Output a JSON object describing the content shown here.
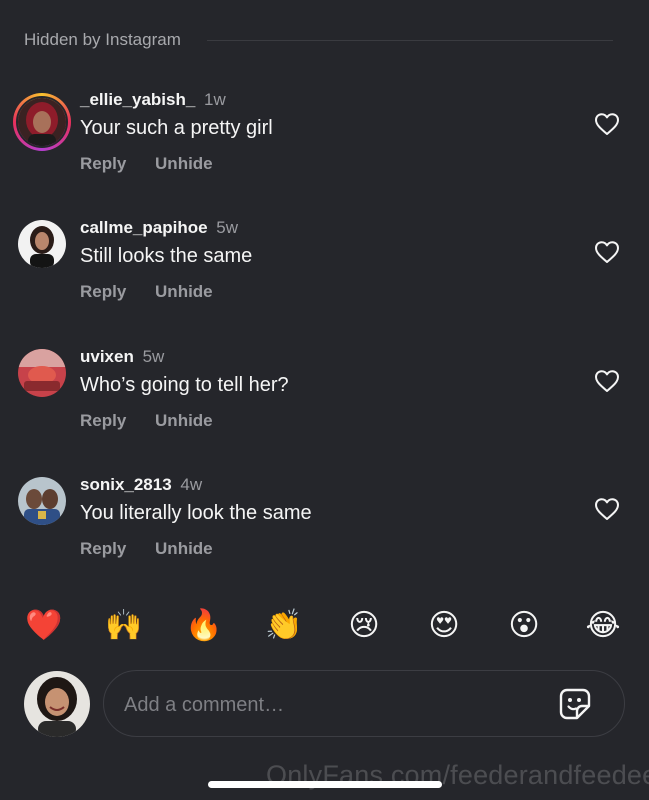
{
  "section": {
    "label": "Hidden by Instagram"
  },
  "comments": [
    {
      "username": "_ellie_yabish_",
      "time": "1w",
      "text": "Your such a pretty girl",
      "reply_label": "Reply",
      "unhide_label": "Unhide",
      "has_story_ring": true
    },
    {
      "username": "callme_papihoe",
      "time": "5w",
      "text": "Still looks the same",
      "reply_label": "Reply",
      "unhide_label": "Unhide",
      "has_story_ring": false
    },
    {
      "username": "uvixen",
      "time": "5w",
      "text": "Who’s going to tell her?",
      "reply_label": "Reply",
      "unhide_label": "Unhide",
      "has_story_ring": false
    },
    {
      "username": "sonix_2813",
      "time": "4w",
      "text": "You literally look the same",
      "reply_label": "Reply",
      "unhide_label": "Unhide",
      "has_story_ring": false
    }
  ],
  "reactions": [
    {
      "emoji": "❤️",
      "name": "red-heart"
    },
    {
      "emoji": "🙌",
      "name": "raising-hands"
    },
    {
      "emoji": "🔥",
      "name": "fire"
    },
    {
      "emoji": "👏",
      "name": "clapping-hands"
    },
    {
      "emoji": "😢",
      "name": "crying-face"
    },
    {
      "emoji": "😍",
      "name": "heart-eyes"
    },
    {
      "emoji": "😮",
      "name": "open-mouth"
    },
    {
      "emoji": "😂",
      "name": "tears-of-joy"
    }
  ],
  "composer": {
    "placeholder": "Add a comment…"
  },
  "watermark": "OnlyFans.com/feederandfeedee",
  "colors": {
    "background": "#25262b",
    "text_primary": "#f5f5f5",
    "text_secondary": "#9a9ba0"
  },
  "icons": {
    "like": "heart-outline-icon",
    "sticker": "sticker-icon"
  }
}
